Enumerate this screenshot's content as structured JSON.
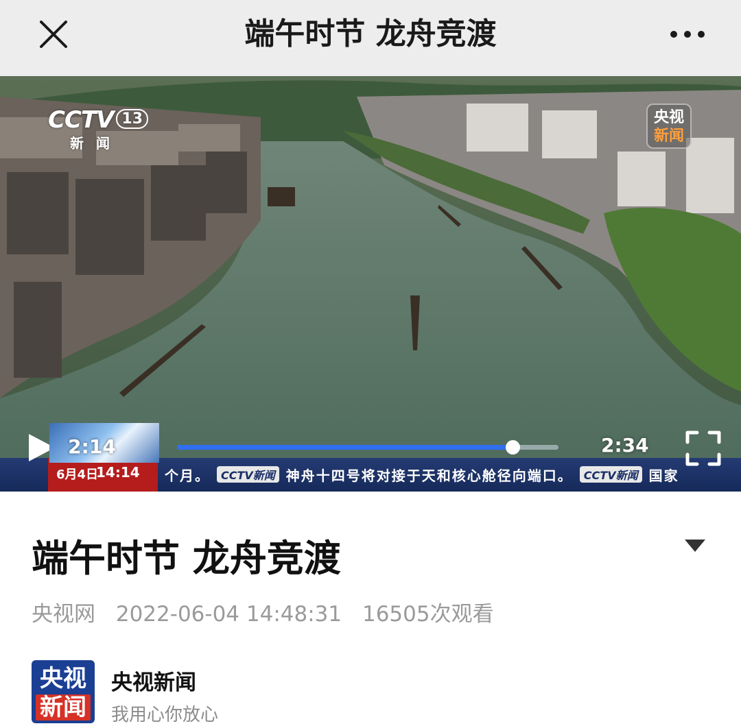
{
  "topbar": {
    "title": "端午时节 龙舟竞渡",
    "close_icon": "close-icon",
    "more_icon": "more-icon"
  },
  "video": {
    "watermark_cctv": "CCTV",
    "watermark_channel": "13",
    "watermark_sub": "新闻",
    "badge_line1": "央视",
    "badge_line2": "新闻",
    "preview_time": "2:14",
    "duration": "2:34",
    "progress_fraction": 0.88,
    "ticker_date": "6月4日",
    "ticker_clock": "14:14",
    "ticker_text_1": "个月。",
    "ticker_chip": "CCTV新闻",
    "ticker_text_2": "神舟十四号将对接于天和核心舱径向端口。",
    "ticker_text_3": "国家",
    "colors": {
      "progress": "#2f6ff0",
      "ticker_bg": "#1d3266",
      "date_bg": "#b51c1c"
    }
  },
  "article": {
    "title": "端午时节 龙舟竞渡",
    "source": "央视网",
    "datetime": "2022-06-04 14:48:31",
    "views": "16505次观看"
  },
  "channel": {
    "logo_line1": "央视",
    "logo_line2": "新闻",
    "name": "央视新闻",
    "slogan": "我用心你放心"
  }
}
